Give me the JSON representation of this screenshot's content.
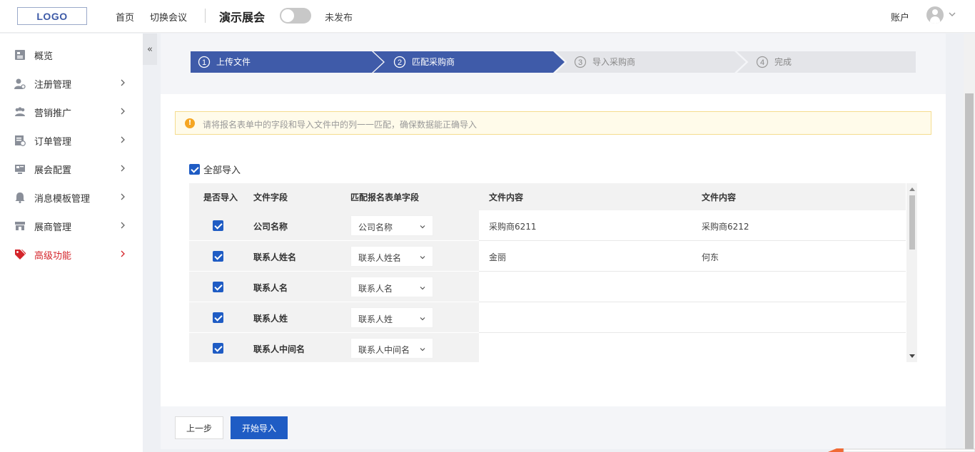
{
  "header": {
    "logo": "LOGO",
    "nav": [
      "首页",
      "切换会议"
    ],
    "event_title": "演示展会",
    "publish_status": "未发布",
    "account": "账户"
  },
  "sidebar": {
    "items": [
      {
        "label": "概览",
        "icon": "overview-icon"
      },
      {
        "label": "注册管理",
        "icon": "user-register-icon"
      },
      {
        "label": "营销推广",
        "icon": "marketing-icon"
      },
      {
        "label": "订单管理",
        "icon": "order-icon"
      },
      {
        "label": "展会配置",
        "icon": "config-icon"
      },
      {
        "label": "消息模板管理",
        "icon": "bell-icon"
      },
      {
        "label": "展商管理",
        "icon": "exhibitor-icon"
      },
      {
        "label": "高级功能",
        "icon": "tag-icon"
      }
    ],
    "active_color": "#d4242a"
  },
  "steps": [
    {
      "num": "1",
      "label": "上传文件",
      "state": "done"
    },
    {
      "num": "2",
      "label": "匹配采购商",
      "state": "active"
    },
    {
      "num": "3",
      "label": "导入采购商",
      "state": "pending"
    },
    {
      "num": "4",
      "label": "完成",
      "state": "pending"
    }
  ],
  "notice": {
    "icon": "!",
    "text": "请将报名表单中的字段和导入文件中的列一一匹配，确保数据能正确导入"
  },
  "select_all_label": "全部导入",
  "table": {
    "headers": [
      "是否导入",
      "文件字段",
      "匹配报名表单字段",
      "文件内容",
      "文件内容"
    ],
    "rows": [
      {
        "field": "公司名称",
        "match": "公司名称",
        "content1": "采购商6211",
        "content2": "采购商6212"
      },
      {
        "field": "联系人姓名",
        "match": "联系人姓名",
        "content1": "金丽",
        "content2": "何东"
      },
      {
        "field": "联系人名",
        "match": "联系人名",
        "content1": "",
        "content2": ""
      },
      {
        "field": "联系人姓",
        "match": "联系人姓",
        "content1": "",
        "content2": ""
      },
      {
        "field": "联系人中间名",
        "match": "联系人中间名",
        "content1": "",
        "content2": ""
      }
    ]
  },
  "buttons": {
    "prev": "上一步",
    "start": "开始导入"
  },
  "colors": {
    "primary": "#1f5cc4",
    "step_active": "#3f5ba9",
    "step_pending": "#e4e5e9"
  }
}
